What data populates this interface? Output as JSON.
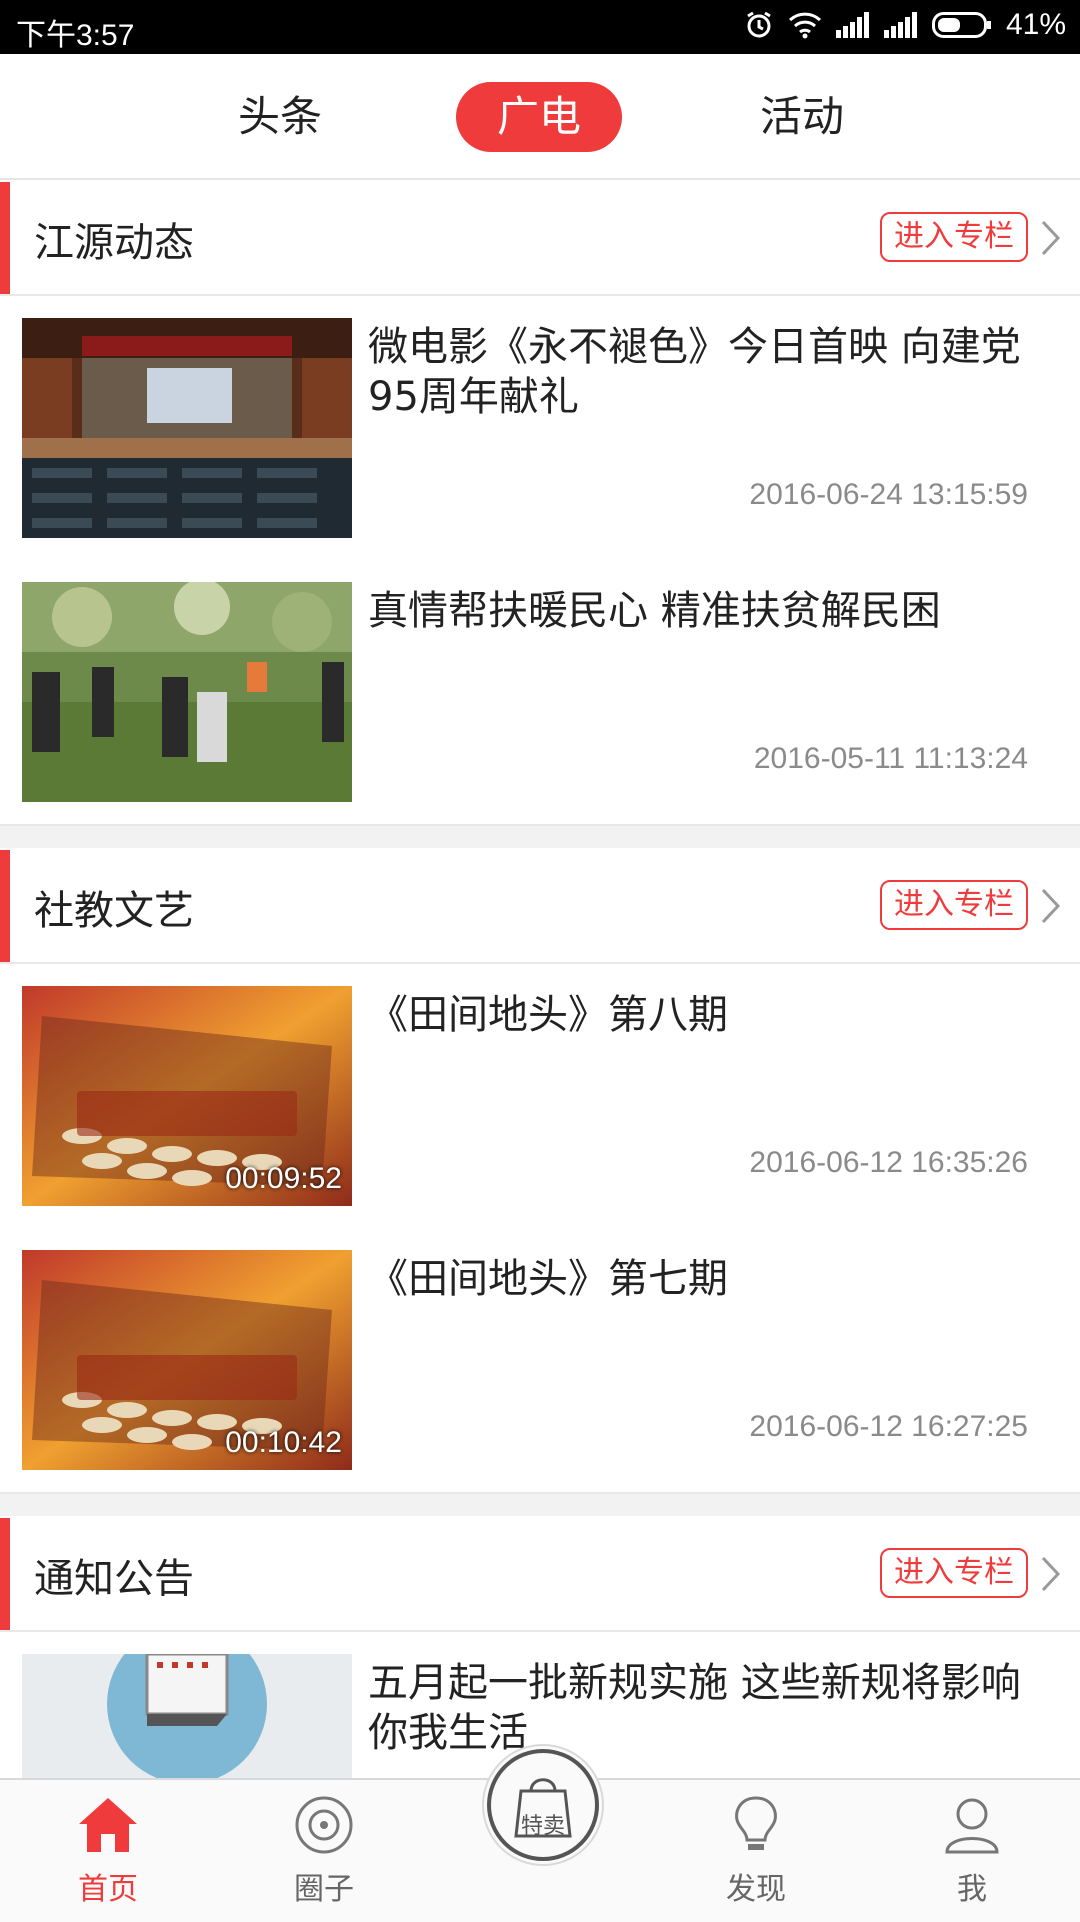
{
  "status_bar": {
    "time": "下午3:57",
    "battery": "41%",
    "icons": [
      "alarm-icon",
      "wifi-icon",
      "signal-icon",
      "signal-icon",
      "battery-icon"
    ]
  },
  "top_tabs": [
    {
      "label": "头条",
      "active": false
    },
    {
      "label": "广电",
      "active": true
    },
    {
      "label": "活动",
      "active": false
    }
  ],
  "sections": [
    {
      "title": "江源动态",
      "enter_label": "进入专栏",
      "items": [
        {
          "headline": "微电影《永不褪色》今日首映 向建党95周年献礼",
          "date": "2016-06-24 13:15:59"
        },
        {
          "headline": "真情帮扶暖民心 精准扶贫解民困",
          "date": "2016-05-11 11:13:24"
        }
      ]
    },
    {
      "title": "社教文艺",
      "enter_label": "进入专栏",
      "items": [
        {
          "headline": "《田间地头》第八期",
          "date": "2016-06-12 16:35:26",
          "duration": "00:09:52"
        },
        {
          "headline": "《田间地头》第七期",
          "date": "2016-06-12 16:27:25",
          "duration": "00:10:42"
        }
      ]
    },
    {
      "title": "通知公告",
      "enter_label": "进入专栏",
      "items": [
        {
          "headline": "五月起一批新规实施 这些新规将影响你我生活"
        }
      ]
    }
  ],
  "bottom_nav": {
    "items": [
      {
        "label": "首页",
        "icon": "home-icon",
        "active": true
      },
      {
        "label": "圈子",
        "icon": "circle-icon",
        "active": false
      },
      {
        "label": "特卖",
        "icon": "shopping-bag-icon",
        "active": false
      },
      {
        "label": "发现",
        "icon": "lightbulb-icon",
        "active": false
      },
      {
        "label": "我",
        "icon": "person-icon",
        "active": false
      }
    ]
  },
  "colors": {
    "accent": "#ef3b3b",
    "text": "#222222",
    "muted": "#8a8a8a"
  }
}
